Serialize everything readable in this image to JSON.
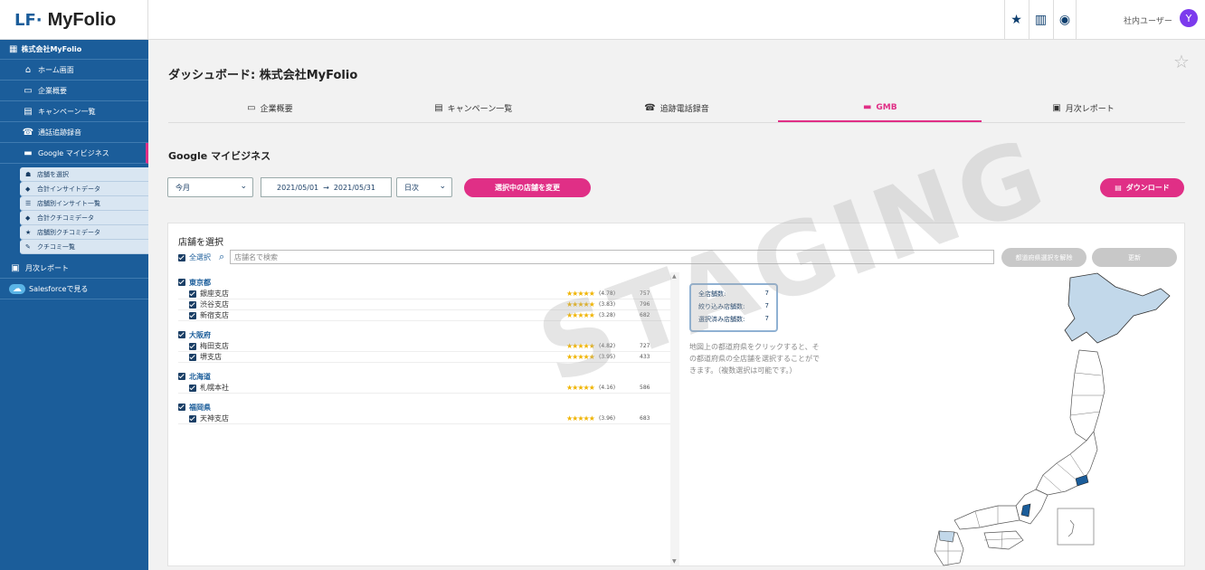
{
  "brand": {
    "logo_mark": "LF·",
    "name": "MyFolio"
  },
  "topbar": {
    "icons": [
      "star-icon",
      "building-icon",
      "dashboard-icon"
    ],
    "user_name": "社内ユーザー",
    "avatar_letter": "Y"
  },
  "sidebar": {
    "company": "株式会社MyFolio",
    "items": [
      {
        "label": "ホーム画面",
        "icon": "home-icon"
      },
      {
        "label": "企業概要",
        "icon": "id-card-icon"
      },
      {
        "label": "キャンペーン一覧",
        "icon": "list-icon"
      },
      {
        "label": "通話追跡録音",
        "icon": "phone-icon"
      },
      {
        "label": "Google マイビジネス",
        "icon": "store-icon"
      }
    ],
    "sub_items": [
      {
        "label": "店舗を選択",
        "icon": "store-select-icon"
      },
      {
        "label": "合計インサイトデータ",
        "icon": "insight-icon"
      },
      {
        "label": "店舗別インサイト一覧",
        "icon": "table-icon"
      },
      {
        "label": "合計クチコミデータ",
        "icon": "review-icon"
      },
      {
        "label": "店舗別クチコミデータ",
        "icon": "star-icon"
      },
      {
        "label": "クチコミ一覧",
        "icon": "comment-icon"
      }
    ],
    "bottom_items": [
      {
        "label": "月次レポート",
        "icon": "report-icon"
      },
      {
        "label": "Salesforceで見る",
        "icon": "salesforce-icon"
      }
    ]
  },
  "page": {
    "title": "ダッシュボード: 株式会社MyFolio",
    "tabs": [
      {
        "label": "企業概要",
        "icon": "id-card-icon"
      },
      {
        "label": "キャンペーン一覧",
        "icon": "list-icon"
      },
      {
        "label": "追跡電話録音",
        "icon": "phone-icon"
      },
      {
        "label": "GMB",
        "icon": "store-icon",
        "active": true
      },
      {
        "label": "月次レポート",
        "icon": "report-icon"
      }
    ],
    "section_title": "Google マイビジネス"
  },
  "filters": {
    "period": "今月",
    "date_from": "2021/05/01",
    "date_arrow": "→",
    "date_to": "2021/05/31",
    "granularity": "日次",
    "change_button": "選択中の店舗を変更",
    "download_button": "ダウンロード"
  },
  "store_panel": {
    "heading": "店舗を選択",
    "select_all": "全選択",
    "search_placeholder": "店舗名で検索",
    "pref_select_button": "都道府県選択を解除",
    "update_button": "更新",
    "prefectures": [
      {
        "name": "東京都",
        "stores": [
          {
            "name": "銀座支店",
            "stars": "★★★★★",
            "rating": "(4.78)",
            "count": "757"
          },
          {
            "name": "渋谷支店",
            "stars": "★★★★★",
            "rating": "(3.83)",
            "count": "796"
          },
          {
            "name": "新宿支店",
            "stars": "★★★★★",
            "rating": "(3.28)",
            "count": "682"
          }
        ]
      },
      {
        "name": "大阪府",
        "stores": [
          {
            "name": "梅田支店",
            "stars": "★★★★★",
            "rating": "(4.82)",
            "count": "727"
          },
          {
            "name": "堺支店",
            "stars": "★★★★★",
            "rating": "(3.95)",
            "count": "433"
          }
        ]
      },
      {
        "name": "北海道",
        "stores": [
          {
            "name": "札幌本社",
            "stars": "★★★★★",
            "rating": "(4.16)",
            "count": "586"
          }
        ]
      },
      {
        "name": "福岡県",
        "stores": [
          {
            "name": "天神支店",
            "stars": "★★★★★",
            "rating": "(3.96)",
            "count": "683"
          }
        ]
      }
    ],
    "counts": [
      {
        "label": "全店舗数:",
        "value": "7"
      },
      {
        "label": "絞り込み店舗数:",
        "value": "7"
      },
      {
        "label": "選択済み店舗数:",
        "value": "7"
      }
    ],
    "map_note": "地図上の都道府県をクリックすると、その都道府県の全店舗を選択することができます。（複数選択は可能です。）"
  },
  "watermark": "STAGING",
  "colors": {
    "sidebar": "#1b5d9a",
    "accent": "#e02f86",
    "map_selected": "#1b5d9a",
    "map_highlight": "#c2d8ea"
  }
}
